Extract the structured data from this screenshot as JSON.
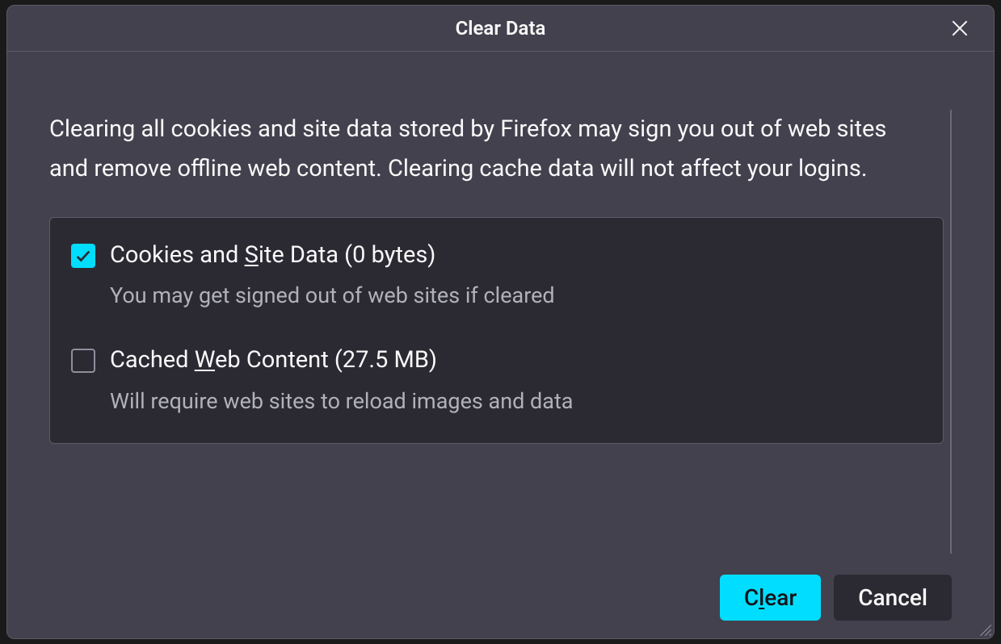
{
  "dialog": {
    "title": "Clear Data",
    "description": "Clearing all cookies and site data stored by Firefox may sign you out of web sites and remove offline web content. Clearing cache data will not affect your logins.",
    "options": [
      {
        "checked": true,
        "label_pre": "Cookies and ",
        "label_underline": "S",
        "label_post": "ite Data (0 bytes)",
        "sub": "You may get signed out of web sites if cleared"
      },
      {
        "checked": false,
        "label_pre": "Cached ",
        "label_underline": "W",
        "label_post": "eb Content (27.5 MB)",
        "sub": "Will require web sites to reload images and data"
      }
    ],
    "buttons": {
      "primary_pre": "C",
      "primary_underline": "l",
      "primary_post": "ear",
      "secondary": "Cancel"
    }
  }
}
